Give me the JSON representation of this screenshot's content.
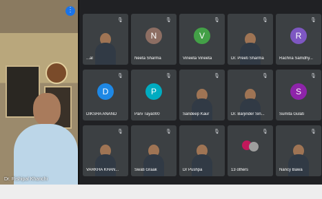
{
  "speaker": {
    "name": "Dr. Rishipal Khanchi",
    "more_icon": "more-vertical-icon"
  },
  "tiles": [
    {
      "name": "...al",
      "initial": "",
      "color": "#3c4043",
      "photo": true
    },
    {
      "name": "Neeta Sharma",
      "initial": "N",
      "color": "#8d6e63"
    },
    {
      "name": "Vineeta Vineeta",
      "initial": "V",
      "color": "#43a047"
    },
    {
      "name": "Dr. Preeti Sharma",
      "initial": "",
      "color": "#3c4043",
      "photo": true
    },
    {
      "name": "Rachna Samdhy...",
      "initial": "R",
      "color": "#7e57c2"
    },
    {
      "name": "DIKSHA ANAND",
      "initial": "D",
      "color": "#1e88e5"
    },
    {
      "name": "Parv Taya000",
      "initial": "P",
      "color": "#00acc1"
    },
    {
      "name": "Sandeep Kaur",
      "initial": "",
      "color": "#3c4043",
      "photo": true
    },
    {
      "name": "Dr. Barjinder Sin...",
      "initial": "",
      "color": "#3c4043",
      "photo": true
    },
    {
      "name": "Sumita Gulati",
      "initial": "S",
      "color": "#8e24aa"
    },
    {
      "name": "VARKHA KHAN...",
      "initial": "",
      "color": "#3c4043",
      "photo": true
    },
    {
      "name": "Swati Graak",
      "initial": "",
      "color": "#3c4043",
      "photo": true
    },
    {
      "name": "Dr Pushpa",
      "initial": "",
      "color": "#3c4043",
      "photo": true
    },
    {
      "name": "13 others",
      "initial": "",
      "color": "#3c4043",
      "others": true
    },
    {
      "name": "Nancy Bawa",
      "initial": "",
      "color": "#3c4043",
      "photo": true
    }
  ]
}
